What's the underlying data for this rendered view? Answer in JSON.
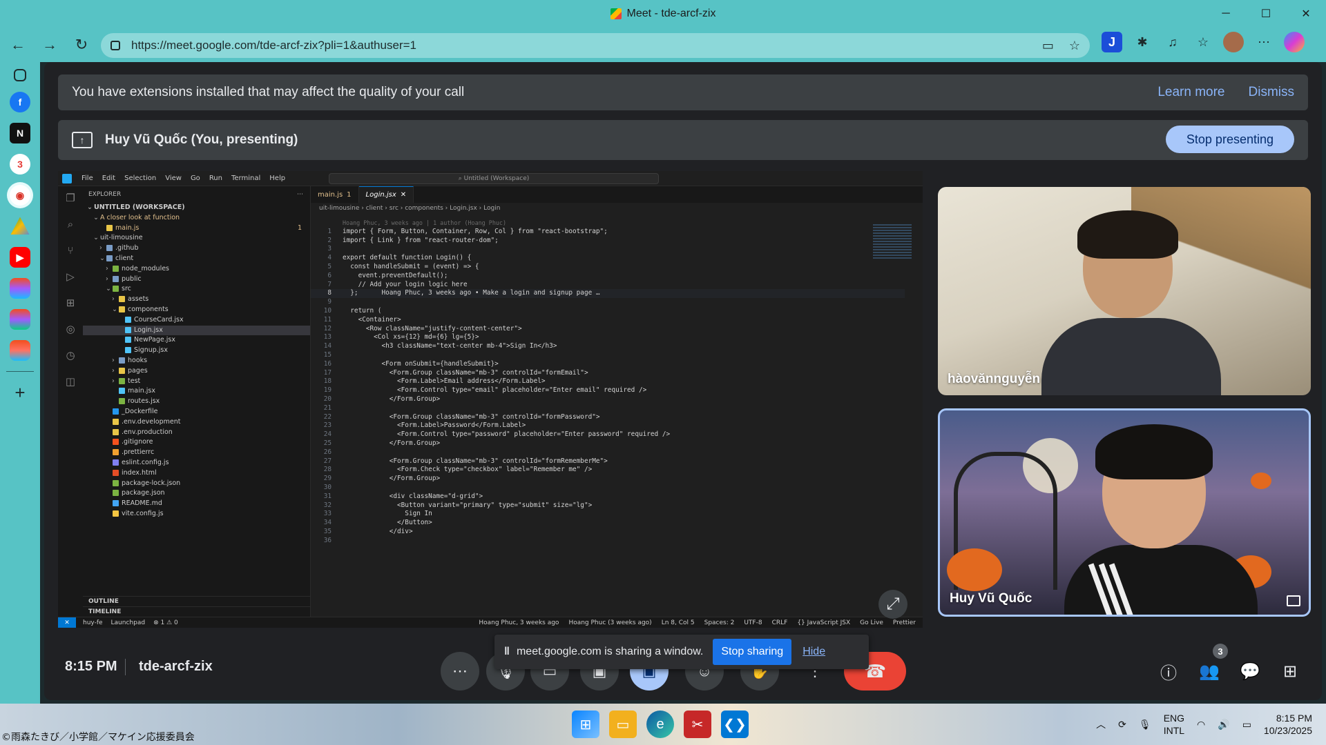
{
  "browser": {
    "window_title": "Meet - tde-arcf-zix",
    "url": "https://meet.google.com/tde-arcf-zix?pli=1&authuser=1",
    "window_controls": {
      "minimize": "─",
      "maximize": "☐",
      "close": "✕"
    }
  },
  "meet": {
    "extension_banner": {
      "message": "You have extensions installed that may affect the quality of your call",
      "learn_more": "Learn more",
      "dismiss": "Dismiss"
    },
    "presenting_banner": {
      "label": "Huy Vũ Quốc (You, presenting)",
      "stop_button": "Stop presenting"
    },
    "participants": [
      {
        "name": "hàovănnguyễn"
      },
      {
        "name": "Huy Vũ Quốc"
      }
    ],
    "bottom": {
      "time": "8:15 PM",
      "meeting_code": "tde-arcf-zix",
      "sharing_message": "meet.google.com is sharing a window.",
      "stop_sharing": "Stop sharing",
      "hide": "Hide",
      "people_count": "3"
    }
  },
  "vscode": {
    "menu": [
      "File",
      "Edit",
      "Selection",
      "View",
      "Go",
      "Run",
      "Terminal",
      "Help"
    ],
    "search": "Untitled (Workspace)",
    "explorer_title": "EXPLORER",
    "tabs": [
      {
        "label": "main.js",
        "badge": "1"
      },
      {
        "label": "Login.jsx",
        "close": "✕"
      }
    ],
    "breadcrumb": "uit-limousine › client › src › components › Login.jsx › Login",
    "tree": [
      {
        "label": "UNTITLED (WORKSPACE)",
        "indent": 0,
        "arrow": "⌄",
        "bold": true
      },
      {
        "label": "A closer look at function",
        "indent": 1,
        "arrow": "⌄",
        "mod": true
      },
      {
        "label": "main.js",
        "indent": 2,
        "mod": true,
        "badge": "1",
        "icon": "#e8c547"
      },
      {
        "label": "uit-limousine",
        "indent": 1,
        "arrow": "⌄"
      },
      {
        "label": ".github",
        "indent": 2,
        "arrow": "›",
        "icon": "#7a9cc6"
      },
      {
        "label": "client",
        "indent": 2,
        "arrow": "⌄",
        "icon": "#7a9cc6"
      },
      {
        "label": "node_modules",
        "indent": 3,
        "arrow": "›",
        "icon": "#7cb342"
      },
      {
        "label": "public",
        "indent": 3,
        "arrow": "›",
        "icon": "#7a9cc6"
      },
      {
        "label": "src",
        "indent": 3,
        "arrow": "⌄",
        "icon": "#7cb342"
      },
      {
        "label": "assets",
        "indent": 4,
        "arrow": "›",
        "icon": "#e8c547"
      },
      {
        "label": "components",
        "indent": 4,
        "arrow": "⌄",
        "icon": "#e8c547"
      },
      {
        "label": "CourseCard.jsx",
        "indent": 5,
        "icon": "#4fc3f7"
      },
      {
        "label": "Login.jsx",
        "indent": 5,
        "icon": "#4fc3f7",
        "selected": true
      },
      {
        "label": "NewPage.jsx",
        "indent": 5,
        "icon": "#4fc3f7"
      },
      {
        "label": "Signup.jsx",
        "indent": 5,
        "icon": "#4fc3f7"
      },
      {
        "label": "hooks",
        "indent": 4,
        "arrow": "›",
        "icon": "#7a9cc6"
      },
      {
        "label": "pages",
        "indent": 4,
        "arrow": "›",
        "icon": "#e8c547"
      },
      {
        "label": "test",
        "indent": 4,
        "arrow": "›",
        "icon": "#7cb342"
      },
      {
        "label": "main.jsx",
        "indent": 4,
        "icon": "#4fc3f7"
      },
      {
        "label": "routes.jsx",
        "indent": 4,
        "icon": "#7cb342"
      },
      {
        "label": "_Dockerfile",
        "indent": 3,
        "icon": "#2496ed"
      },
      {
        "label": ".env.development",
        "indent": 3,
        "icon": "#e8c547"
      },
      {
        "label": ".env.production",
        "indent": 3,
        "icon": "#e8c547"
      },
      {
        "label": ".gitignore",
        "indent": 3,
        "icon": "#f4511e"
      },
      {
        "label": ".prettierrc",
        "indent": 3,
        "icon": "#f0a030"
      },
      {
        "label": "eslint.config.js",
        "indent": 3,
        "icon": "#8080f2"
      },
      {
        "label": "index.html",
        "indent": 3,
        "icon": "#e44d26"
      },
      {
        "label": "package-lock.json",
        "indent": 3,
        "icon": "#7cb342"
      },
      {
        "label": "package.json",
        "indent": 3,
        "icon": "#7cb342"
      },
      {
        "label": "README.md",
        "indent": 3,
        "icon": "#42a5f5"
      },
      {
        "label": "vite.config.js",
        "indent": 3,
        "icon": "#f4c542"
      }
    ],
    "outline": [
      "OUTLINE",
      "TIMELINE"
    ],
    "code_lines": [
      {
        "n": "",
        "t": "Hoang Phuc, 3 weeks ago | 1 author (Hoang Phuc)",
        "blame": true
      },
      {
        "n": "1",
        "t": "import { Form, Button, Container, Row, Col } from \"react-bootstrap\";"
      },
      {
        "n": "2",
        "t": "import { Link } from \"react-router-dom\";"
      },
      {
        "n": "3",
        "t": ""
      },
      {
        "n": "4",
        "t": "export default function Login() {"
      },
      {
        "n": "5",
        "t": "  const handleSubmit = (event) => {"
      },
      {
        "n": "6",
        "t": "    event.preventDefault();"
      },
      {
        "n": "7",
        "t": "    // Add your login logic here"
      },
      {
        "n": "8",
        "t": "  };      Hoang Phuc, 3 weeks ago • Make a login and signup page …",
        "cur": true
      },
      {
        "n": "9",
        "t": ""
      },
      {
        "n": "10",
        "t": "  return ("
      },
      {
        "n": "11",
        "t": "    <Container>"
      },
      {
        "n": "12",
        "t": "      <Row className=\"justify-content-center\">"
      },
      {
        "n": "13",
        "t": "        <Col xs={12} md={6} lg={5}>"
      },
      {
        "n": "14",
        "t": "          <h3 className=\"text-center mb-4\">Sign In</h3>"
      },
      {
        "n": "15",
        "t": ""
      },
      {
        "n": "16",
        "t": "          <Form onSubmit={handleSubmit}>"
      },
      {
        "n": "17",
        "t": "            <Form.Group className=\"mb-3\" controlId=\"formEmail\">"
      },
      {
        "n": "18",
        "t": "              <Form.Label>Email address</Form.Label>"
      },
      {
        "n": "19",
        "t": "              <Form.Control type=\"email\" placeholder=\"Enter email\" required />"
      },
      {
        "n": "20",
        "t": "            </Form.Group>"
      },
      {
        "n": "21",
        "t": ""
      },
      {
        "n": "22",
        "t": "            <Form.Group className=\"mb-3\" controlId=\"formPassword\">"
      },
      {
        "n": "23",
        "t": "              <Form.Label>Password</Form.Label>"
      },
      {
        "n": "24",
        "t": "              <Form.Control type=\"password\" placeholder=\"Enter password\" required />"
      },
      {
        "n": "25",
        "t": "            </Form.Group>"
      },
      {
        "n": "26",
        "t": ""
      },
      {
        "n": "27",
        "t": "            <Form.Group className=\"mb-3\" controlId=\"formRememberMe\">"
      },
      {
        "n": "28",
        "t": "              <Form.Check type=\"checkbox\" label=\"Remember me\" />"
      },
      {
        "n": "29",
        "t": "            </Form.Group>"
      },
      {
        "n": "30",
        "t": ""
      },
      {
        "n": "31",
        "t": "            <div className=\"d-grid\">"
      },
      {
        "n": "32",
        "t": "              <Button variant=\"primary\" type=\"submit\" size=\"lg\">"
      },
      {
        "n": "33",
        "t": "                Sign In"
      },
      {
        "n": "34",
        "t": "              </Button>"
      },
      {
        "n": "35",
        "t": "            </div>"
      },
      {
        "n": "36",
        "t": ""
      }
    ],
    "status_left": [
      "huy-fe",
      "Launchpad",
      "⊗ 1 ⚠ 0"
    ],
    "status_right": [
      "Hoang Phuc, 3 weeks ago",
      "Hoang Phuc (3 weeks ago)",
      "Ln 8, Col 5",
      "Spaces: 2",
      "UTF-8",
      "CRLF",
      "{} JavaScript JSX",
      "Go Live",
      "Prettier"
    ]
  },
  "taskbar": {
    "wallpaper_credit": "©雨森たきび／小学館／マケイン応援委員会",
    "lang_top": "ENG",
    "lang_bottom": "INTL",
    "time": "8:15 PM",
    "date": "10/23/2025"
  },
  "colors": {
    "edge_chrome": "#57c3c5",
    "meet_background": "#202124",
    "accent_blue": "#a8c7fa",
    "leave_red": "#ea4335"
  }
}
